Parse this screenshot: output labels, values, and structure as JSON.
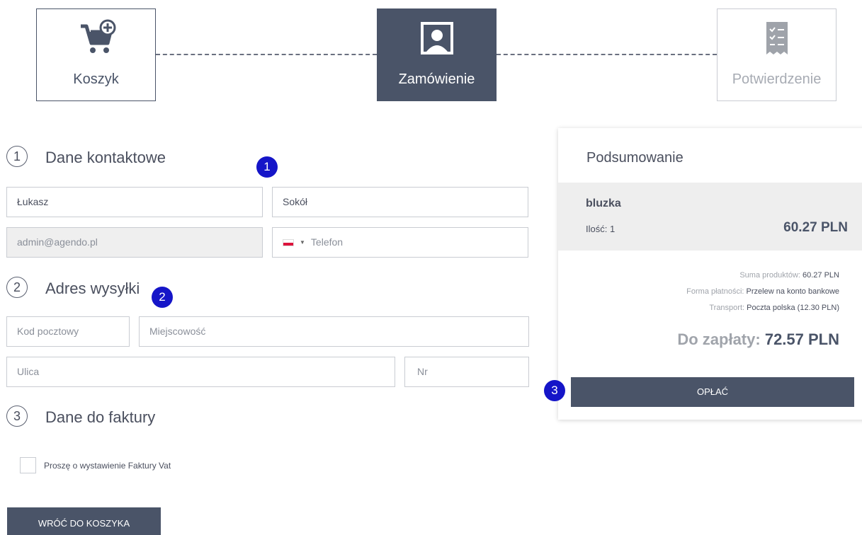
{
  "steps": [
    {
      "label": "Koszyk",
      "icon": "cart-plus-icon"
    },
    {
      "label": "Zamówienie",
      "icon": "user-portrait-icon"
    },
    {
      "label": "Potwierdzenie",
      "icon": "checklist-icon"
    }
  ],
  "sections": {
    "contact": {
      "number": "1",
      "title": "Dane kontaktowe"
    },
    "shipping": {
      "number": "2",
      "title": "Adres wysyłki"
    },
    "invoice": {
      "number": "3",
      "title": "Dane do faktury"
    }
  },
  "contact_form": {
    "first_name": "Łukasz",
    "last_name": "Sokół",
    "email": "admin@agendo.pl",
    "phone_placeholder": "Telefon"
  },
  "shipping_form": {
    "postal_code_placeholder": "Kod pocztowy",
    "city_placeholder": "Miejscowość",
    "street_placeholder": "Ulica",
    "number_placeholder": "Nr"
  },
  "invoice": {
    "checkbox_label": "Proszę o wystawienie Faktury Vat"
  },
  "badges": [
    "1",
    "2",
    "3"
  ],
  "buttons": {
    "back": "WRÓĆ DO KOSZYKA",
    "pay": "OPŁAĆ"
  },
  "summary": {
    "title": "Podsumowanie",
    "item": {
      "name": "bluzka",
      "quantity": "Ilość: 1",
      "price": "60.27 PLN"
    },
    "products_sum_label": "Suma produktów:",
    "products_sum_value": "60.27 PLN",
    "payment_label": "Forma płatności:",
    "payment_value": "Przelew na konto bankowe",
    "transport_label": "Transport:",
    "transport_value": "Poczta polska (12.30 PLN)",
    "total_label": "Do zapłaty:",
    "total_value": "72.57 PLN"
  },
  "colors": {
    "primary": "#4a5468",
    "badge": "#1515c8",
    "muted": "#a0a4ab"
  }
}
